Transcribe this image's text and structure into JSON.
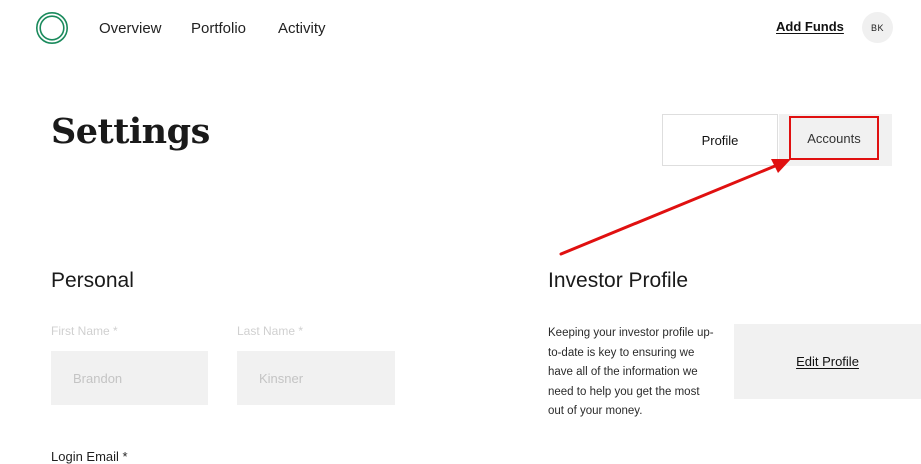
{
  "header": {
    "logo_icon": "ring-logo-icon",
    "brand_color": "#1a8a5c",
    "nav": [
      {
        "label": "Overview"
      },
      {
        "label": "Portfolio"
      },
      {
        "label": "Activity"
      }
    ],
    "add_funds_label": "Add Funds",
    "avatar_initials": "BK"
  },
  "page": {
    "title": "Settings",
    "tabs": [
      {
        "label": "Profile",
        "active": true
      },
      {
        "label": "Accounts",
        "active": false
      }
    ]
  },
  "personal": {
    "title": "Personal",
    "first_name": {
      "label": "First Name *",
      "value": "Brandon"
    },
    "last_name": {
      "label": "Last Name *",
      "value": "Kinsner"
    },
    "login_email_label": "Login Email *"
  },
  "investor_profile": {
    "title": "Investor Profile",
    "description": "Keeping your investor profile up-to-date is key to ensuring we have all of the information we need to help you get the most out of your money.",
    "edit_label": "Edit Profile"
  },
  "annotation": {
    "color": "#e01010",
    "icon": "red-arrow-annotation"
  }
}
